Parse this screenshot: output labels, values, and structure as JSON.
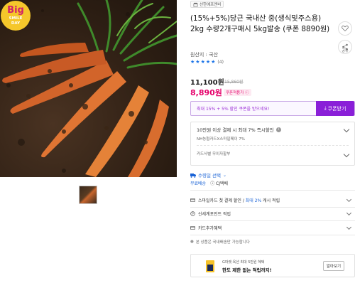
{
  "badge": {
    "line1": "Big",
    "line2": "SMILE",
    "line3": "DAY"
  },
  "seller": {
    "name": "선한에프엔비"
  },
  "product": {
    "title": "(15%+5%)당근 국내산 중(생식및주스용) 2kg 수량2개구매시 5kg발송 (쿠폰 8890원)",
    "origin": "원산지 : 국산",
    "rating_stars": 5,
    "rating_count": "(4)"
  },
  "price": {
    "sale": "11,100원",
    "original": "15,860원",
    "coupon_price": "8,890원",
    "coupon_tag": "쿠폰적용가"
  },
  "coupon_bar": {
    "text": "최대 15% + 5% 할인 쿠폰을 받으세요!",
    "button": "쿠폰받기"
  },
  "card_benefit": {
    "line1": "10만원 이상 결제 시 최대 7% 즉시할인",
    "line2": "NH농협카드X스마일페이 7%",
    "line3": "카드사별 무이자할부"
  },
  "shipping": {
    "title": "수령일 선택",
    "free": "무료배송",
    "courier": "CJ택배"
  },
  "menu": {
    "smilecard_prefix": "스마일카드 첫 결제 할인 / ",
    "smilecard_highlight": "최대 2%",
    "smilecard_suffix": " 캐시 적립",
    "shinsegae": "신세계포인트 적립",
    "card_extra": "카드추가혜택"
  },
  "domestic_note": "본 상품은 국내배송만 가능합니다",
  "banner": {
    "line1": "G마켓·옥션 최대 5만원 혜택",
    "line2": "한도 제한 없는 적립까지!",
    "button": "알아보기"
  },
  "side_icons": {
    "share_label": "공유"
  },
  "colors": {
    "accent_purple": "#8a1fd8",
    "price_pink": "#e5006a",
    "link_blue": "#1a63d6"
  }
}
